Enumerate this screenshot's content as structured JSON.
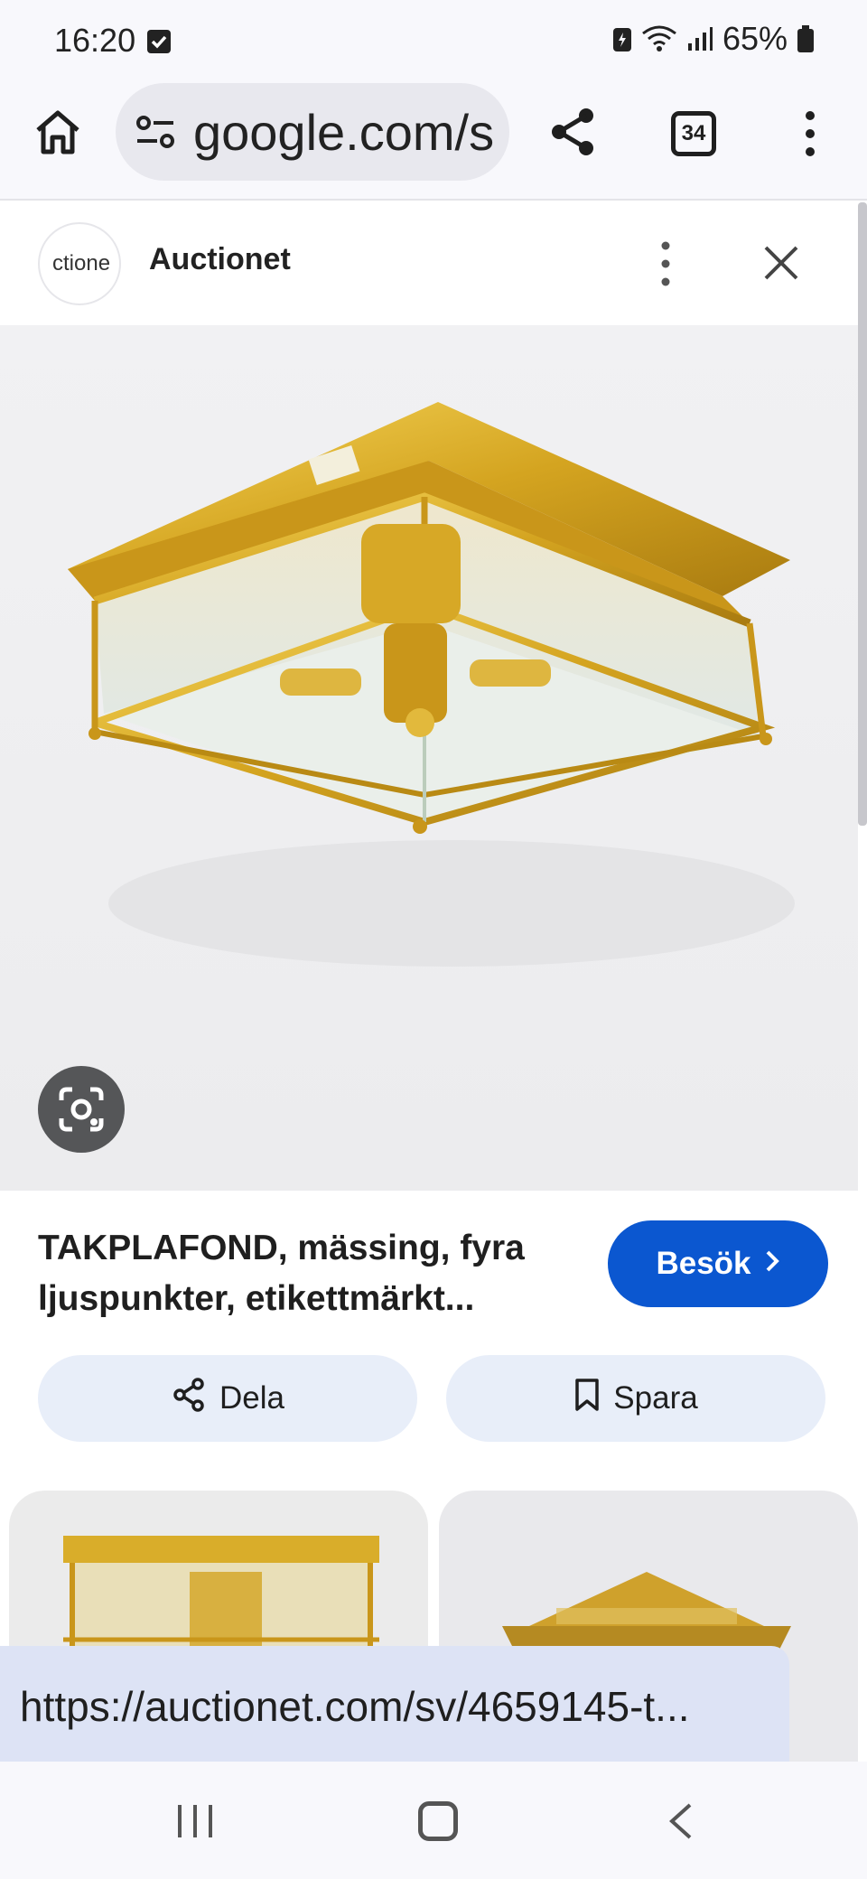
{
  "status_bar": {
    "time": "16:20",
    "battery": "65%",
    "icons": [
      "notification-check-icon",
      "battery-saver-icon",
      "wifi-icon",
      "signal-icon",
      "battery-icon"
    ]
  },
  "browser": {
    "url": "google.com/s",
    "tab_count": "34",
    "icons": [
      "home-icon",
      "site-settings-icon",
      "share-icon",
      "tabs-icon",
      "more-vert-icon"
    ]
  },
  "panel": {
    "site_logo_text": "ctione",
    "site_name": "Auctionet",
    "icons": [
      "more-vert-icon",
      "close-icon",
      "lens-icon"
    ]
  },
  "result": {
    "title": "TAKPLAFOND, mässing, fyra ljuspunkter, etikettmärkt...",
    "visit_label": "Besök",
    "share_label": "Dela",
    "save_label": "Spara"
  },
  "url_hover": {
    "text": "https://auctionet.com/sv/4659145-t..."
  },
  "nav_bar": {
    "icons": [
      "recent-apps-icon",
      "home-nav-icon",
      "back-icon"
    ]
  },
  "colors": {
    "accent": "#0b57d0",
    "pill_bg": "#e8eef9",
    "brass": "#d4a420"
  }
}
